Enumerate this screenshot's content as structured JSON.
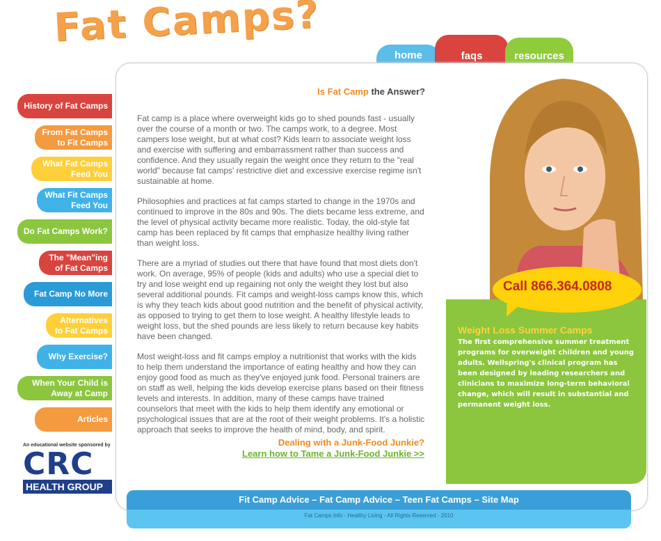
{
  "site_title": "Fat Camps?",
  "tabs": [
    {
      "label": "home"
    },
    {
      "label": "faqs"
    },
    {
      "label": "resources"
    }
  ],
  "sidebar": {
    "items": [
      {
        "label": "History of Fat Camps",
        "color": "#d9443f"
      },
      {
        "label": "From Fat Camps\nto Fit Camps",
        "color": "#f49a3f"
      },
      {
        "label": "What Fat Camps\nFeed You",
        "color": "#ffcf3a"
      },
      {
        "label": "What Fit Camps\nFeed You",
        "color": "#3fb2e8"
      },
      {
        "label": "Do Fat Camps Work?",
        "color": "#8bc63e"
      },
      {
        "label": "The \"Mean\"ing\nof Fat Camps",
        "color": "#d9443f"
      },
      {
        "label": "Fat Camp No More",
        "color": "#2a9bd6"
      },
      {
        "label": "Alternatives\nto Fat Camps",
        "color": "#ffcf3a"
      },
      {
        "label": "Why Exercise?",
        "color": "#3fb2e8"
      },
      {
        "label": "When Your Child is\nAway at Camp",
        "color": "#8bc63e"
      },
      {
        "label": "Articles",
        "color": "#f49a3f"
      }
    ]
  },
  "sponsor": {
    "text": "An educational website sponsored by",
    "logo_main": "CRC",
    "logo_sub": "HEALTH GROUP"
  },
  "article": {
    "title_highlight": "Is Fat Camp",
    "title_rest": "the Answer?",
    "paragraphs": [
      "Fat camp is a place where overweight kids go to shed pounds fast - usually over the course of a month or two. The camps work, to a degree. Most campers lose weight, but at what cost? Kids learn to associate weight loss and exercise with suffering and embarrassment rather than success and confidence. And they usually regain the weight once they return to the \"real world\" because fat camps' restrictive diet and excessive exercise regime isn't sustainable at home.",
      "Philosophies and practices at fat camps started to change in the 1970s and continued to improve in the 80s and 90s. The diets became less extreme, and the level of physical activity became more realistic. Today, the old-style fat camp has been replaced by fit camps that emphasize healthy living rather than weight loss.",
      "There are a myriad of studies out there that have found that most diets don't work. On average, 95% of people (kids and adults) who use a special diet to try and lose weight end up regaining not only the weight they lost but also several additional pounds. Fit camps and weight-loss camps know this, which is why they teach kids about good nutrition and the benefit of physical activity, as opposed to trying to get them to lose weight. A healthy lifestyle leads to weight loss, but the shed pounds are less likely to return because key habits have been changed.",
      "Most weight-loss and fit camps employ a nutritionist that works with the kids to help them understand the importance of eating healthy and how they can enjoy good food as much as they've enjoyed junk food. Personal trainers are on staff as well, helping the kids develop exercise plans based on their fitness levels and interests. In addition, many of these camps have trained counselors that meet with the kids to help them identify any emotional or psychological issues that are at the root of their weight problems. It's a holistic approach that seeks to improve the health of mind, body, and spirit."
    ],
    "callout_question": "Dealing with a Junk-Food Junkie?",
    "callout_link": "Learn how to Tame a Junk-Food Junkie >>"
  },
  "promo": {
    "phone": "Call 866.364.0808",
    "title": "Weight Loss Summer Camps",
    "text": "The first comprehensive summer treatment programs for overweight children and young adults. Wellspring's clinical program has been designed by leading researchers and clinicians to maximize long-term behavioral change, which will result in substantial and permanent weight loss."
  },
  "footer": {
    "links": "Fit Camp Advice – Fat Camp Advice – Teen Fat Camps – Site Map",
    "copyright": "Fat Camps Info - Healthy Living - All Rights Reserved - 2010"
  }
}
